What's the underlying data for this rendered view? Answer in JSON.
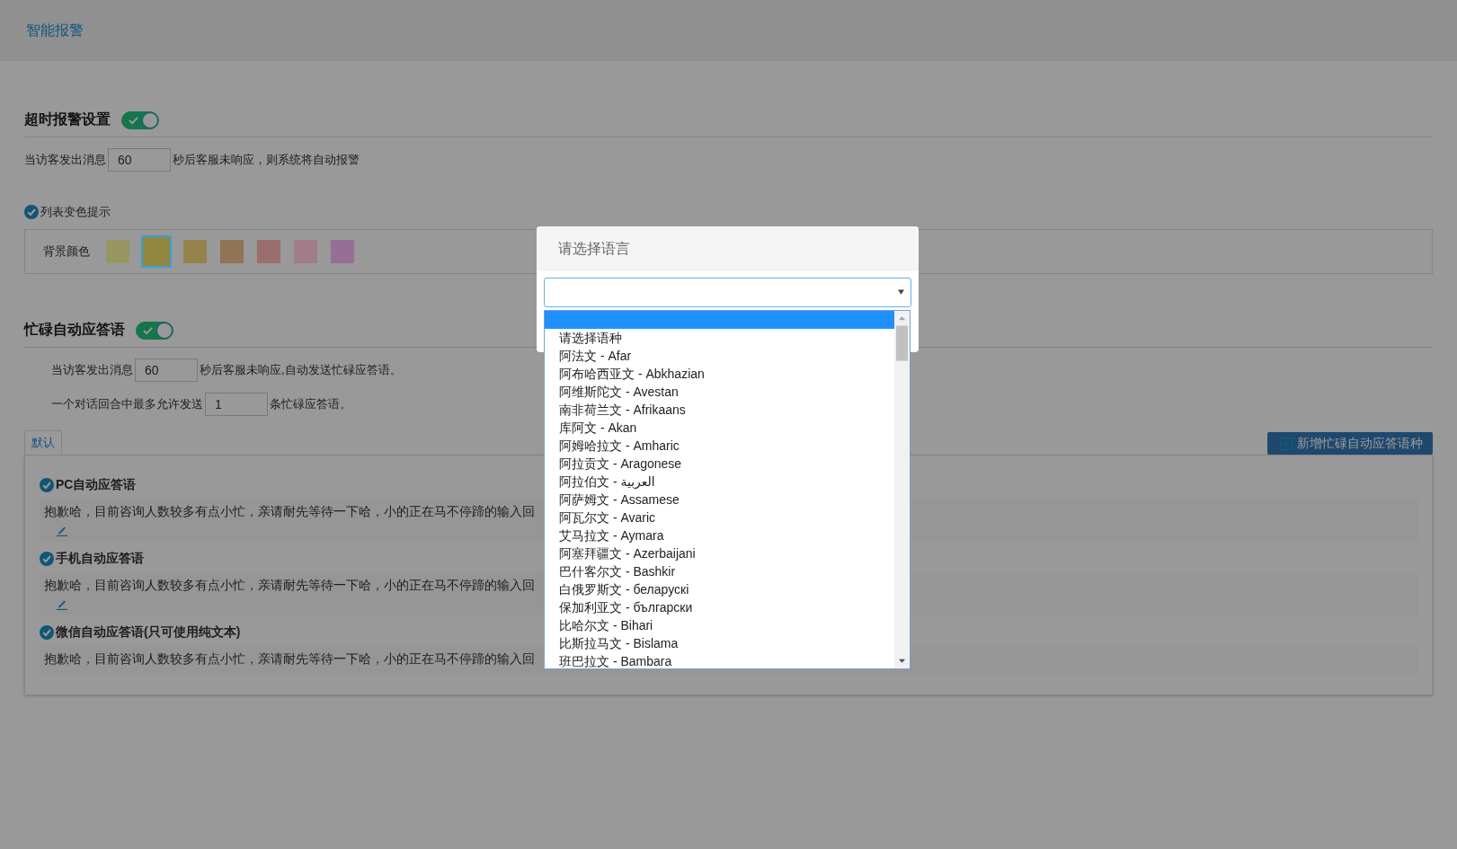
{
  "header": {
    "title": "智能报警"
  },
  "timeout_section": {
    "title": "超时报警设置",
    "on": true,
    "text_before": "当访客发出消息",
    "value": "60",
    "text_after": "秒后客服未响应，则系统将自动报警"
  },
  "list_color_hint": {
    "label": "列表变色提示",
    "checked": true,
    "background_label": "背景颜色",
    "swatches": [
      {
        "color": "#989660",
        "selected": false
      },
      {
        "color": "#918740",
        "selected": true
      },
      {
        "color": "#96824b",
        "selected": false
      },
      {
        "color": "#917355",
        "selected": false
      },
      {
        "color": "#9b6e6e",
        "selected": false
      },
      {
        "color": "#a07d87",
        "selected": false
      },
      {
        "color": "#966e96",
        "selected": false
      }
    ]
  },
  "busy_section": {
    "title": "忙碌自动应答语",
    "on": true,
    "rows": [
      {
        "text_before": "当访客发出消息",
        "value": "60",
        "text_after": "秒后客服未响应,自动发送忙碌应答语。"
      },
      {
        "text_before": "一个对话回合中最多允许发送",
        "value": "1",
        "text_after": "条忙碌应答语。"
      }
    ]
  },
  "tabs": [
    {
      "label": "默认",
      "selected": true
    }
  ],
  "add_button": {
    "label": "新增忙碌自动应答语种"
  },
  "replies": [
    {
      "title": "PC自动应答语",
      "checked": true,
      "text": "抱歉哈，目前咨询人数较多有点小忙，亲请耐先等待一下哈，小的正在马不停蹄的输入回",
      "editable": true
    },
    {
      "title": "手机自动应答语",
      "checked": true,
      "text": "抱歉哈，目前咨询人数较多有点小忙，亲请耐先等待一下哈，小的正在马不停蹄的输入回",
      "editable": true
    },
    {
      "title": "微信自动应答语(只可使用纯文本)",
      "checked": true,
      "text": "抱歉哈，目前咨询人数较多有点小忙，亲请耐先等待一下哈，小的正在马不停蹄的输入回",
      "editable": false
    }
  ],
  "modal": {
    "title": "请选择语言",
    "options": [
      {
        "selected": true
      },
      {
        "label": "请选择语种",
        "selected": false
      },
      {
        "label": "阿法文 - Afar",
        "selected": false
      },
      {
        "label": "阿布哈西亚文 - Abkhazian",
        "selected": false
      },
      {
        "label": "阿维斯陀文 - Avestan",
        "selected": false
      },
      {
        "label": "南非荷兰文 - Afrikaans",
        "selected": false
      },
      {
        "label": "库阿文 - Akan",
        "selected": false
      },
      {
        "label": "阿姆哈拉文 - Amharic",
        "selected": false
      },
      {
        "label": "阿拉贡文 - Aragonese",
        "selected": false
      },
      {
        "label": "阿拉伯文 - العربية",
        "selected": false
      },
      {
        "label": "阿萨姆文 - Assamese",
        "selected": false
      },
      {
        "label": "阿瓦尔文 - Avaric",
        "selected": false
      },
      {
        "label": "艾马拉文 - Aymara",
        "selected": false
      },
      {
        "label": "阿塞拜疆文 - Azerbaijani",
        "selected": false
      },
      {
        "label": "巴什客尔文 - Bashkir",
        "selected": false
      },
      {
        "label": "白俄罗斯文 - беларускі",
        "selected": false
      },
      {
        "label": "保加利亚文 - български",
        "selected": false
      },
      {
        "label": "比哈尔文 - Bihari",
        "selected": false
      },
      {
        "label": "比斯拉马文 - Bislama",
        "selected": false
      },
      {
        "label": "班巴拉文 - Bambara",
        "selected": false
      }
    ]
  }
}
